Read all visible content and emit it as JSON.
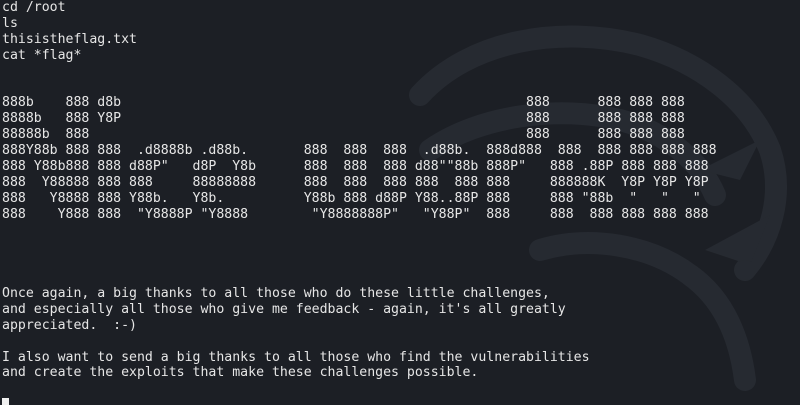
{
  "terminal": {
    "lines": [
      "cd /root",
      "ls",
      "thisistheflag.txt",
      "cat *flag*",
      "",
      "",
      "888b    888 d8b                                                   888      888 888 888",
      "8888b   888 Y8P                                                   888      888 888 888",
      "88888b  888                                                       888      888 888 888",
      "888Y88b 888 888  .d8888b .d88b.       888  888  888  .d88b.  888d888  888  888 888 888 888",
      "888 Y88b888 888 d88P\"   d8P  Y8b      888  888  888 d88\"\"88b 888P\"   888 .88P 888 888 888",
      "888  Y88888 888 888     88888888      888  888  888 888  888 888     888888K  Y8P Y8P Y8P",
      "888   Y8888 888 Y88b.   Y8b.          Y88b 888 d88P Y88..88P 888     888 \"88b  \"   \"   \"",
      "888    Y888 888  \"Y8888P \"Y8888        \"Y8888888P\"   \"Y88P\"  888     888  888 888 888 888",
      "",
      "",
      "",
      "",
      "Once again, a big thanks to all those who do these little challenges,",
      "and especially all those who give me feedback - again, it's all greatly",
      "appreciated.  :-)",
      "",
      "I also want to send a big thanks to all those who find the vulnerabilities",
      "and create the exploits that make these challenges possible.",
      ""
    ]
  },
  "colors": {
    "background": "#1c1f25",
    "foreground": "#e6e6e6",
    "cursor": "#f0f0f0"
  },
  "icons": {
    "background_logo": "kali-dragon-icon",
    "cursor": "block-cursor-icon"
  }
}
